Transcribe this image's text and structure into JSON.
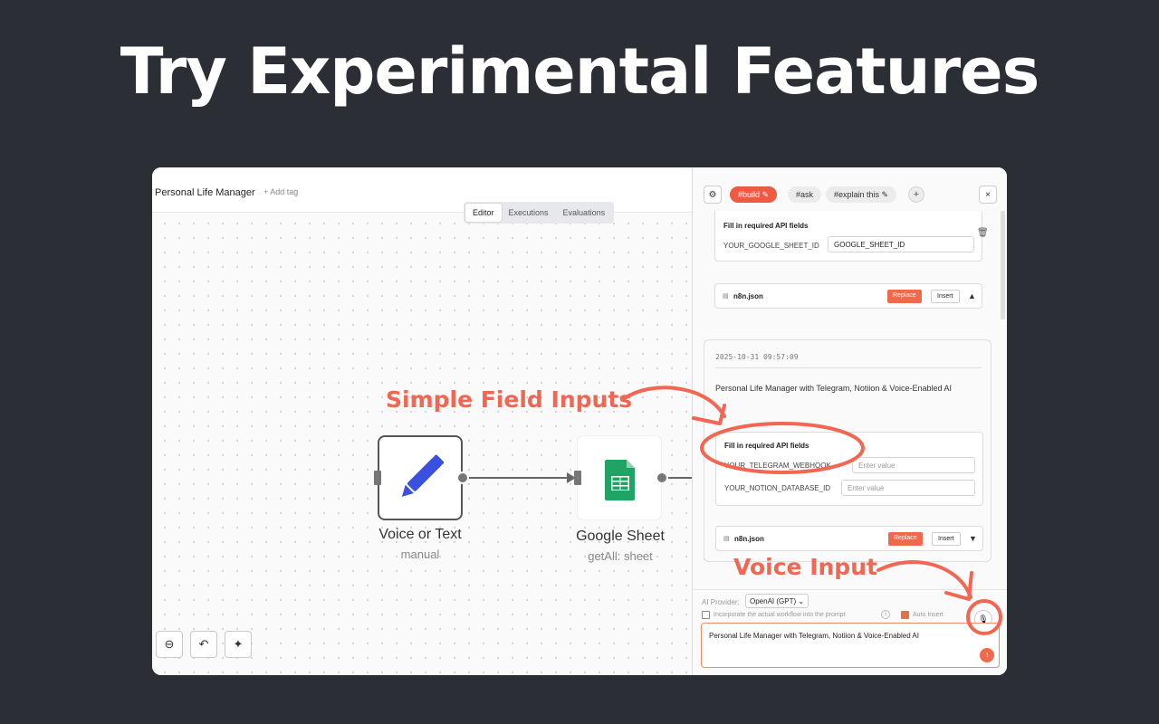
{
  "headline": "Try Experimental Features",
  "workflow": {
    "title": "Personal Life Manager",
    "add_tag": "+ Add tag"
  },
  "mode_tabs": [
    {
      "label": "Editor",
      "active": true
    },
    {
      "label": "Executions",
      "active": false
    },
    {
      "label": "Evaluations",
      "active": false
    }
  ],
  "nodes": [
    {
      "label": "Voice or Text",
      "sub": "manual",
      "icon": "pencil-icon"
    },
    {
      "label": "Google Sheet",
      "sub": "getAll: sheet",
      "icon": "google-sheets-icon"
    }
  ],
  "canvas_tools": [
    {
      "name": "zoom-out-icon",
      "glyph": "⊖"
    },
    {
      "name": "undo-icon",
      "glyph": "↶"
    },
    {
      "name": "clean-canvas-icon",
      "glyph": "✦"
    }
  ],
  "panel": {
    "chips": [
      {
        "label": "#build ✎",
        "active": true
      },
      {
        "label": "#ask",
        "active": false
      },
      {
        "label": "#explain this ✎",
        "active": false
      }
    ],
    "add_chip": "+",
    "close": "×",
    "settings_icon": "⚙",
    "card1": {
      "title": "Fill in required API fields",
      "fields": [
        {
          "label": "YOUR_GOOGLE_SHEET_ID",
          "value": "GOOGLE_SHEET_ID",
          "placeholder": ""
        }
      ]
    },
    "file1": {
      "name": "n8n.json",
      "replace": "Replace",
      "insert": "Insert",
      "caret": "▲"
    },
    "message": {
      "timestamp": "2025-10-31 09:57:09",
      "text": "Personal Life Manager with Telegram, Notiion & Voice-Enabled AI"
    },
    "card2": {
      "title": "Fill in required API fields",
      "fields": [
        {
          "label": "YOUR_TELEGRAM_WEBHOOK",
          "value": "",
          "placeholder": "Enter value"
        },
        {
          "label": "YOUR_NOTION_DATABASE_ID",
          "value": "",
          "placeholder": "Enter value"
        }
      ]
    },
    "file2": {
      "name": "n8n.json",
      "replace": "Replace",
      "insert": "Insert",
      "caret": "▼"
    },
    "footer": {
      "provider_label": "AI Provider:",
      "provider_value": "OpenAI (GPT) ⌄",
      "incorporate_label": "Incorporate the actual workflow into the prompt",
      "info_icon": "i",
      "auto_insert_label": "Auto Insert",
      "prompt_value": "Personal Life Manager with Telegram, Notiion & Voice-Enabled AI",
      "mic_icon": "🎙",
      "send_icon": "↑"
    }
  },
  "annotations": {
    "field_inputs": "Simple Field Inputs",
    "voice_input": "Voice Input",
    "color": "#f26652"
  }
}
